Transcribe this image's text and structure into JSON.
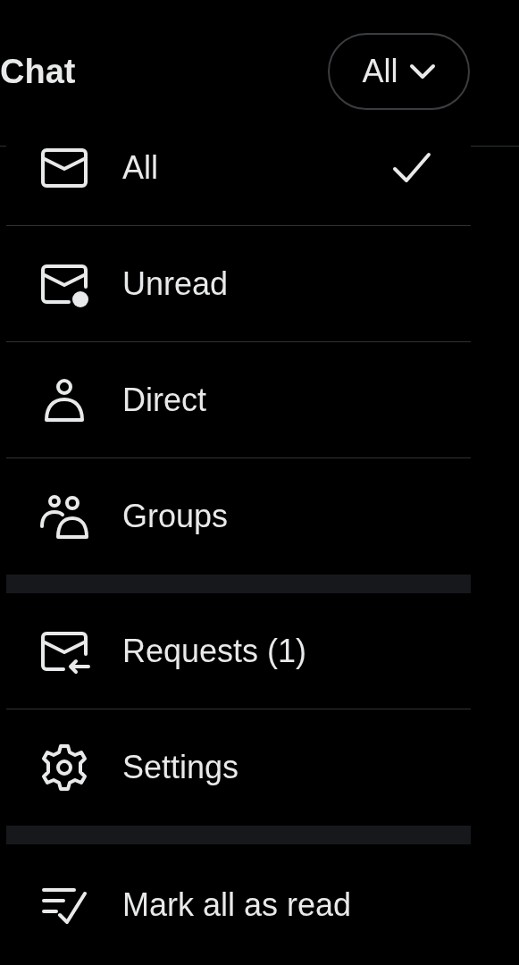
{
  "header": {
    "title": "Chat",
    "filter": {
      "label": "All",
      "expanded": true
    }
  },
  "menu": {
    "sections": [
      [
        {
          "label": "All",
          "selected": true
        },
        {
          "label": "Unread",
          "selected": false
        },
        {
          "label": "Direct",
          "selected": false
        },
        {
          "label": "Groups",
          "selected": false
        }
      ],
      [
        {
          "label": "Requests (1)"
        },
        {
          "label": "Settings"
        }
      ],
      [
        {
          "label": "Mark all as read"
        }
      ]
    ]
  }
}
